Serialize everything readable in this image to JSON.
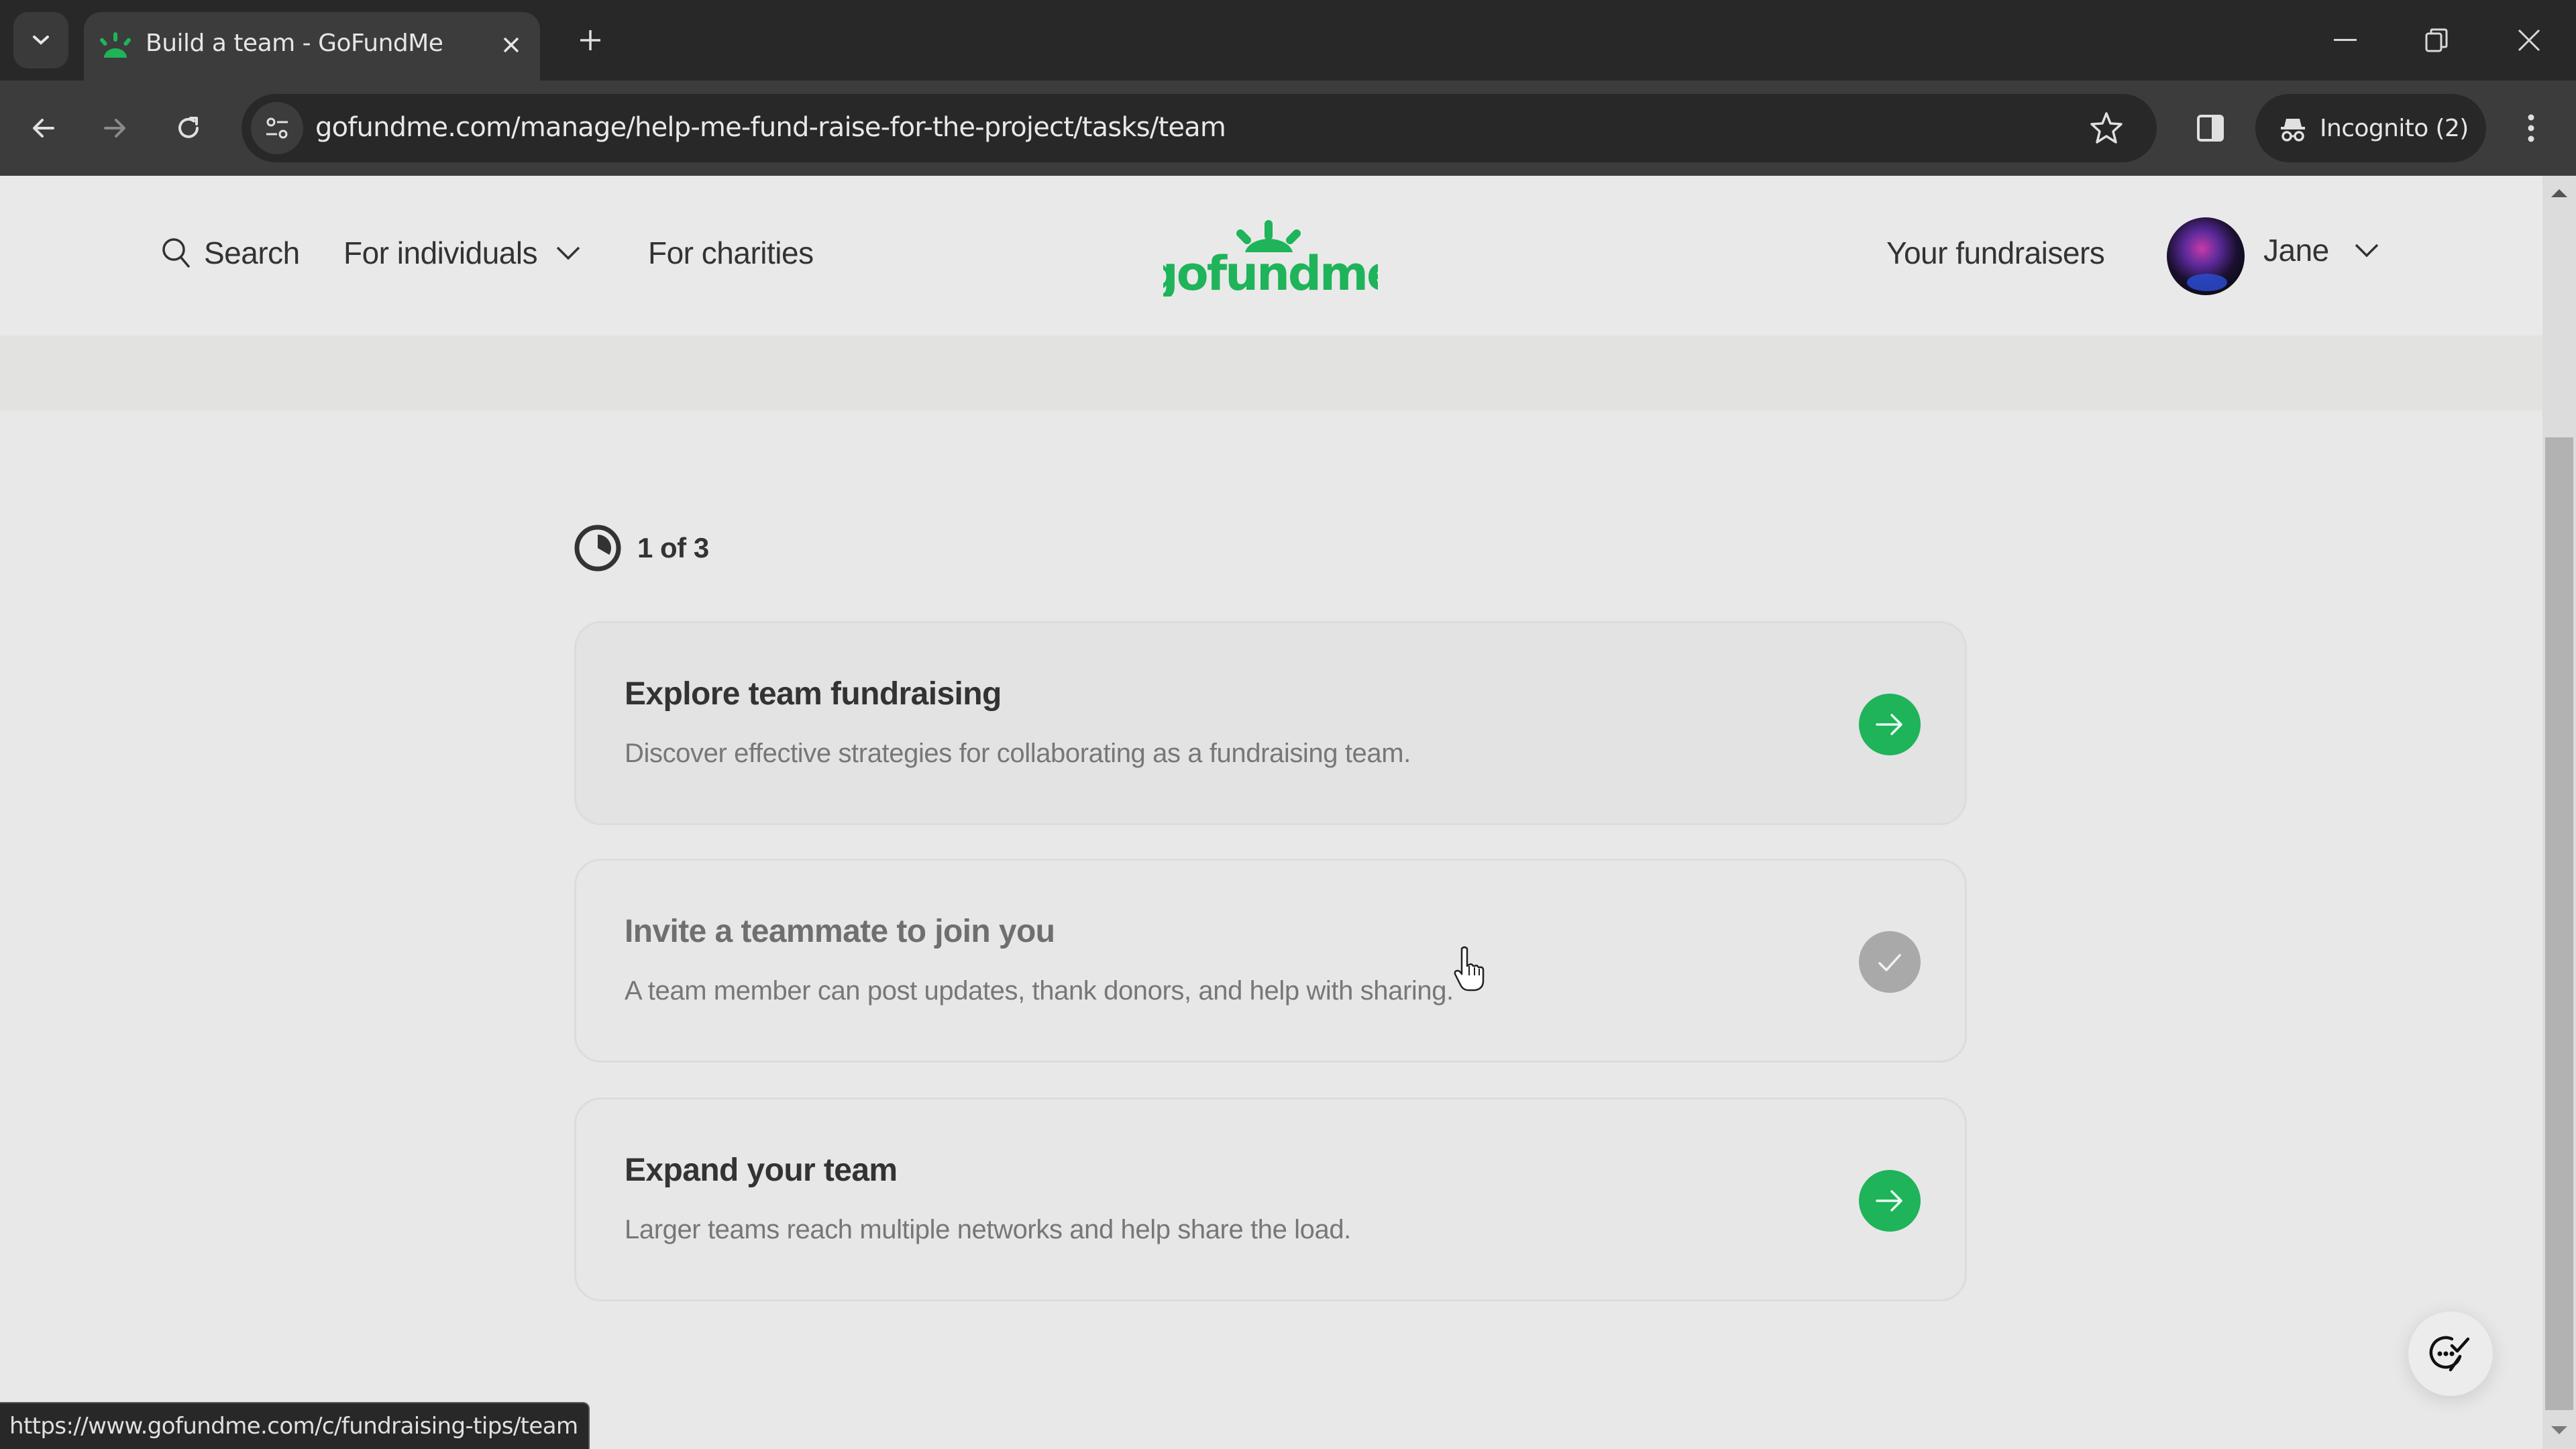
{
  "browser": {
    "tab_title": "Build a team - GoFundMe",
    "url": "gofundme.com/manage/help-me-fund-raise-for-the-project/tasks/team",
    "incognito_label": "Incognito (2)",
    "status_url": "https://www.gofundme.com/c/fundraising-tips/team"
  },
  "header": {
    "search_label": "Search",
    "nav": [
      {
        "label": "For individuals",
        "has_dropdown": true
      },
      {
        "label": "For charities",
        "has_dropdown": false
      }
    ],
    "logo_text": "gofundme",
    "your_fundraisers": "Your fundraisers",
    "user_name": "Jane"
  },
  "progress": {
    "label": "1 of 3",
    "completed": 1,
    "total": 3
  },
  "tasks": [
    {
      "title": "Explore team fundraising",
      "description": "Discover effective strategies for collaborating as a fundraising team.",
      "status": "open",
      "action_icon": "arrow-right-icon"
    },
    {
      "title": "Invite a teammate to join you",
      "description": "A team member can post updates, thank donors, and help with sharing.",
      "status": "completed",
      "action_icon": "check-icon"
    },
    {
      "title": "Expand your team",
      "description": "Larger teams reach multiple networks and help share the load.",
      "status": "open",
      "action_icon": "arrow-right-icon"
    }
  ],
  "colors": {
    "brand_green": "#1fb35a",
    "completed_gray": "#a9a9a9",
    "text_dark": "#333333",
    "text_muted": "#777777"
  }
}
